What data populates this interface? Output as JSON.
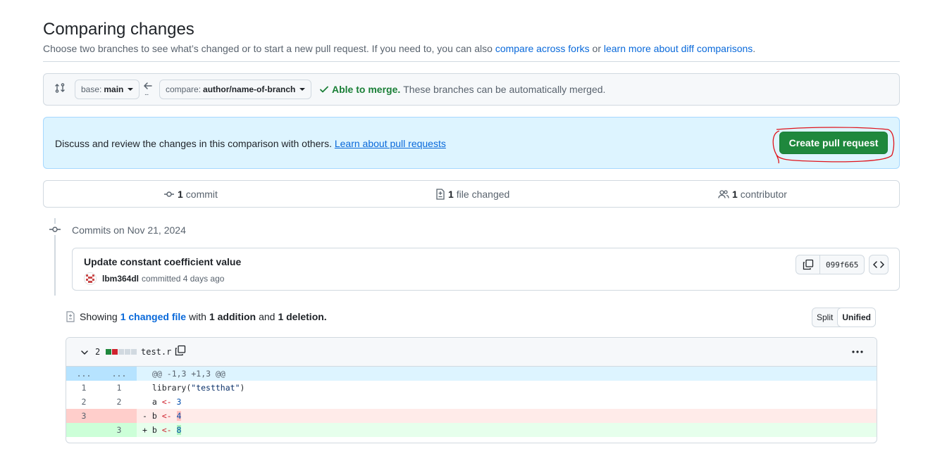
{
  "page": {
    "title": "Comparing changes",
    "subtitle_pre": "Choose two branches to see what’s changed or to start a new pull request. If you need to, you can also",
    "link_forks": "compare across forks",
    "subtitle_or": "or",
    "link_learn_diff": "learn more about diff comparisons",
    "subtitle_end": "."
  },
  "range": {
    "base_prefix": "base:",
    "base_branch": "main",
    "compare_prefix": "compare:",
    "compare_branch": "author/name-of-branch",
    "merge_status": "Able to merge.",
    "merge_message": "These branches can be automatically merged.",
    "ellipsis": "..."
  },
  "discuss": {
    "text": "Discuss and review the changes in this comparison with others.",
    "link": "Learn about pull requests",
    "create_button": "Create pull request"
  },
  "stats": {
    "commits_count": "1",
    "commits_label": "commit",
    "files_count": "1",
    "files_label": "file changed",
    "contributors_count": "1",
    "contributors_label": "contributor"
  },
  "commits": {
    "date_heading": "Commits on Nov 21, 2024",
    "items": [
      {
        "title": "Update constant coefficient value",
        "author": "lbm364dl",
        "action": "committed",
        "time": "4 days ago",
        "sha": "099f665"
      }
    ]
  },
  "toc": {
    "showing": "Showing",
    "changed_files": "1 changed file",
    "with": "with",
    "additions": "1 addition",
    "and": "and",
    "deletions": "1 deletion.",
    "split_label": "Split",
    "unified_label": "Unified",
    "selected_view": "Unified"
  },
  "file": {
    "name": "test.r",
    "change_count": "2",
    "hunk_ln": "...",
    "hunk_header": "@@ -1,3 +1,3 @@",
    "lines": [
      {
        "old": "1",
        "new": "1",
        "marker": " ",
        "code": "library(\"testthat\")"
      },
      {
        "old": "2",
        "new": "2",
        "marker": " ",
        "code": "a <- 3"
      },
      {
        "old": "3",
        "new": "",
        "marker": "-",
        "code": "b <- 4"
      },
      {
        "old": "",
        "new": "3",
        "marker": "+",
        "code": "b <- 8"
      }
    ]
  },
  "colors": {
    "primary_button": "#1f883d",
    "link": "#0969da",
    "success": "#1a7f37",
    "annotation_circle": "#e0141b"
  }
}
